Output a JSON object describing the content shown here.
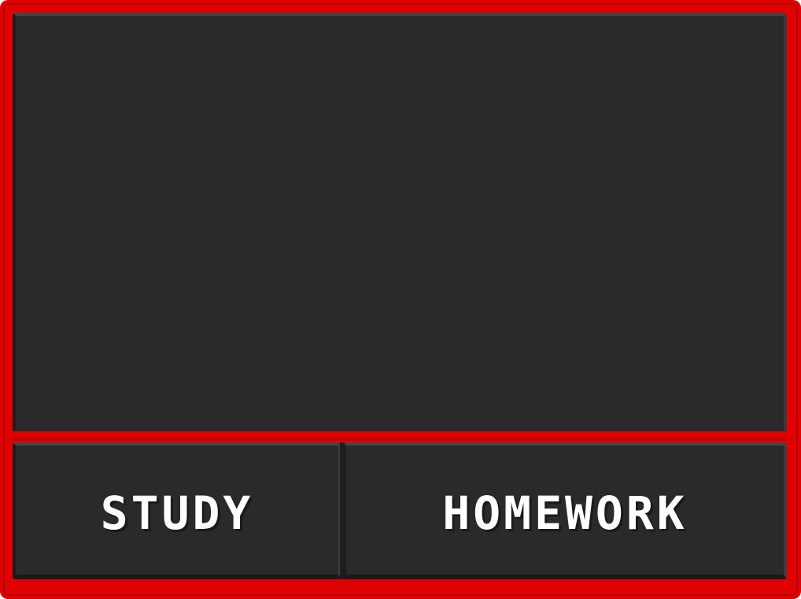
{
  "colors": {
    "frame": "#e00000",
    "panel": "#2a2a2a",
    "label": "#ffffff"
  },
  "display": {
    "content": ""
  },
  "buttons": {
    "study_label": "STUDY",
    "homework_label": "HOMEWORK"
  }
}
